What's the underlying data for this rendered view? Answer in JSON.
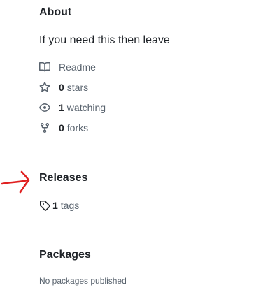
{
  "about": {
    "title": "About",
    "description": "If you need this then leave",
    "readme_label": "Readme",
    "stars_count": "0",
    "stars_label": "stars",
    "watching_count": "1",
    "watching_label": "watching",
    "forks_count": "0",
    "forks_label": "forks",
    "icons": [
      "book-icon",
      "star-icon",
      "eye-icon",
      "repo-forked-icon"
    ]
  },
  "releases": {
    "title": "Releases",
    "tags_count": "1",
    "tags_label": "tags",
    "icon": "tag-icon"
  },
  "packages": {
    "title": "Packages",
    "empty_text": "No packages published"
  },
  "annotation": {
    "icon": "red-hand-drawn-arrow",
    "color": "#e02020"
  },
  "colors": {
    "text_primary": "#1f2328",
    "text_muted": "#59636e",
    "divider": "#d1d9e0"
  }
}
